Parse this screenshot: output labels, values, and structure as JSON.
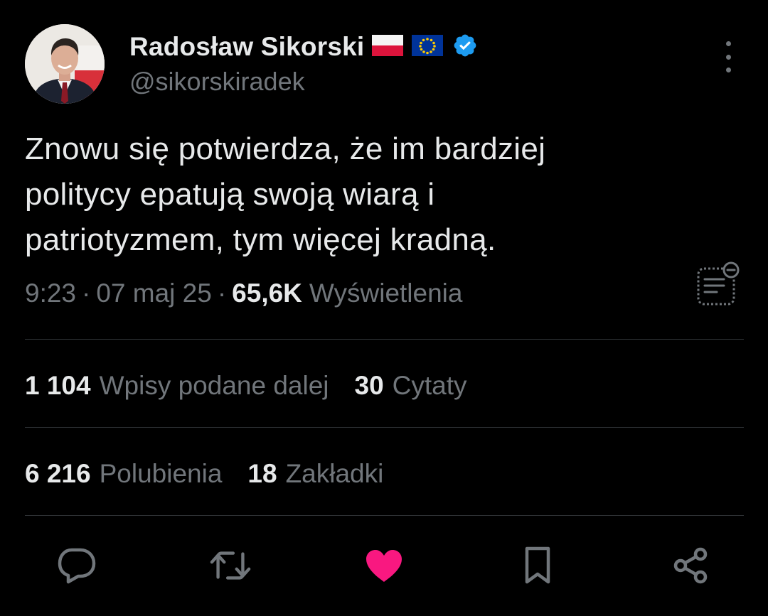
{
  "author": {
    "display_name": "Radosław Sikorski",
    "handle": "@sikorskiradek",
    "badges": [
      "poland-flag-icon",
      "eu-flag-icon",
      "verified-badge-icon"
    ]
  },
  "tweet": {
    "text_lines": [
      "Znowu się potwierdza, że im bardziej",
      "politycy epatują swoją wiarą i",
      "patriotyzmem, tym więcej kradną."
    ],
    "time": "9:23",
    "date": "07 maj 25",
    "separator": "·",
    "views_count": "65,6K",
    "views_label": "Wyświetlenia"
  },
  "stats": {
    "reposts": {
      "count": "1 104",
      "label": "Wpisy podane dalej"
    },
    "quotes": {
      "count": "30",
      "label": "Cytaty"
    },
    "likes": {
      "count": "6 216",
      "label": "Polubienia"
    },
    "bookmarks": {
      "count": "18",
      "label": "Zakładki"
    }
  },
  "actions": [
    "reply-icon",
    "repost-icon",
    "like-icon",
    "bookmark-icon",
    "share-icon"
  ],
  "colors": {
    "background": "#000000",
    "text_primary": "#e7e9ea",
    "text_secondary": "#71767b",
    "divider": "#2f3336",
    "verified": "#1d9bf0",
    "like_active": "#f91880"
  }
}
